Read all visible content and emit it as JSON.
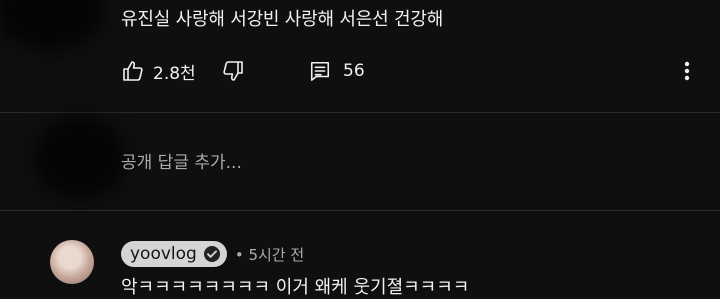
{
  "comment": {
    "text": "유진실 사랑해 서강빈 사랑해 서은선 건강해",
    "likes": "2.8천",
    "replies": "56"
  },
  "reply_input": {
    "placeholder": "공개 답글 추가..."
  },
  "next_comment": {
    "author": "yoovlog",
    "meta": "• 5시간 전",
    "text": "악ㅋㅋㅋㅋㅋㅋㅋㅋ 이거 왜케 웃기졀ㅋㅋㅋㅋ"
  },
  "icons": {
    "like": "thumbs-up-icon",
    "dislike": "thumbs-down-icon",
    "replies": "comment-icon",
    "more": "more-vertical-icon",
    "verified": "verified-check-icon"
  },
  "colors": {
    "background": "#0f0f0f",
    "text": "#f1f1f1",
    "secondary_text": "#aaaaaa",
    "author_chip": "#d4d4d4"
  }
}
